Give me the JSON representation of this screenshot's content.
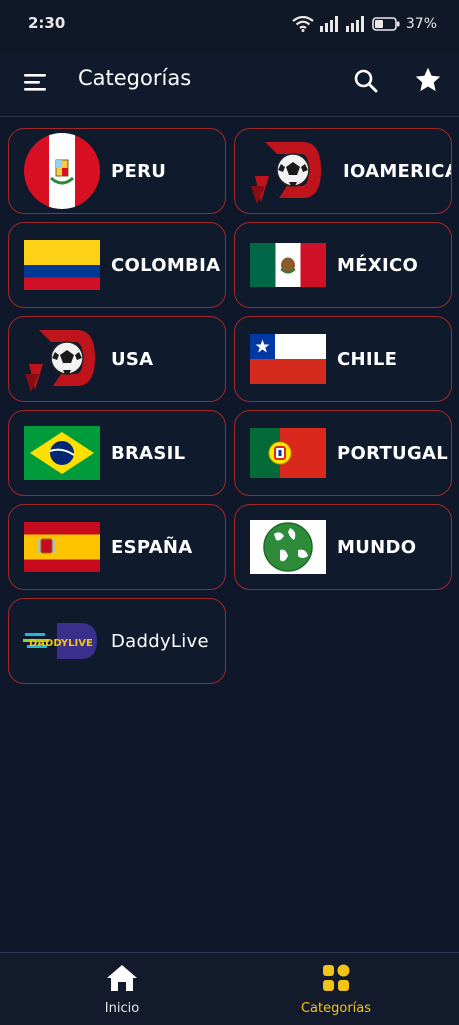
{
  "status": {
    "time": "2:30",
    "battery": "37%"
  },
  "appbar": {
    "title": "Categorías"
  },
  "categories": [
    {
      "label": "PERU",
      "thumb": "peru-flag"
    },
    {
      "label": "IOAMERICA",
      "thumb": "soccer-logo"
    },
    {
      "label": "COLOMBIA",
      "thumb": "colombia-flag"
    },
    {
      "label": "MÉXICO",
      "thumb": "mexico-flag"
    },
    {
      "label": "USA",
      "thumb": "soccer-logo"
    },
    {
      "label": "CHILE",
      "thumb": "chile-flag"
    },
    {
      "label": "BRASIL",
      "thumb": "brazil-flag"
    },
    {
      "label": "PORTUGAL",
      "thumb": "portugal-flag"
    },
    {
      "label": "ESPAÑA",
      "thumb": "spain-flag"
    },
    {
      "label": "MUNDO",
      "thumb": "globe-image"
    },
    {
      "label": "DaddyLive",
      "thumb": "daddylive-logo",
      "logo_text": "DADDYLIVE"
    }
  ],
  "bottom_nav": {
    "home_label": "Inicio",
    "categories_label": "Categorías",
    "active": "Categorías",
    "active_color": "#f3c316"
  },
  "colors": {
    "background": "#0f172a",
    "card_border": "#a02828",
    "accent": "#f3c316"
  }
}
